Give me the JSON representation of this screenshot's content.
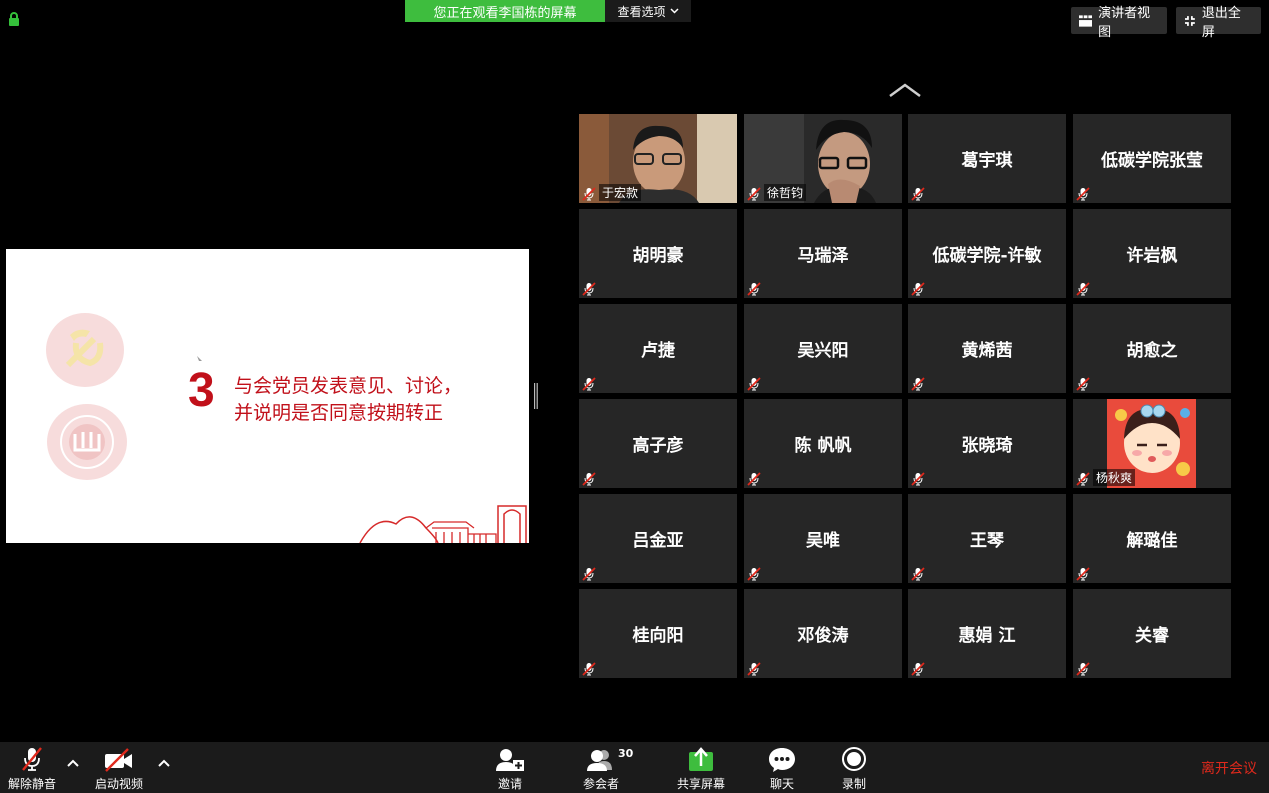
{
  "top": {
    "banner": "您正在观看李国栋的屏幕",
    "view_options": "查看选项",
    "presenter_view": "演讲者视图",
    "exit_fullscreen": "退出全屏"
  },
  "slide": {
    "number": "3",
    "line1": "与会党员发表意见、讨论，",
    "line2": "并说明是否同意按期转正"
  },
  "participants": [
    {
      "name": "于宏款",
      "video": true
    },
    {
      "name": "徐哲钧",
      "video": true
    },
    {
      "name": "葛宇琪"
    },
    {
      "name": "低碳学院张莹"
    },
    {
      "name": "胡明豪"
    },
    {
      "name": "马瑞泽"
    },
    {
      "name": "低碳学院-许敏"
    },
    {
      "name": "许岩枫"
    },
    {
      "name": "卢捷"
    },
    {
      "name": "吴兴阳"
    },
    {
      "name": "黄烯茜"
    },
    {
      "name": "胡愈之"
    },
    {
      "name": "高子彦"
    },
    {
      "name": "陈 帆帆"
    },
    {
      "name": "张晓琦"
    },
    {
      "name": "杨秋爽",
      "avatar": true
    },
    {
      "name": "吕金亚"
    },
    {
      "name": "吴唯"
    },
    {
      "name": "王琴"
    },
    {
      "name": "解璐佳"
    },
    {
      "name": "桂向阳"
    },
    {
      "name": "邓俊涛"
    },
    {
      "name": "惠娟 江"
    },
    {
      "name": "关睿"
    }
  ],
  "toolbar": {
    "unmute": "解除静音",
    "start_video": "启动视频",
    "invite": "邀请",
    "participants": "参会者",
    "participant_count": "30",
    "share_screen": "共享屏幕",
    "chat": "聊天",
    "record": "录制",
    "leave": "离开会议"
  },
  "colors": {
    "accent_green": "#3ebd3e",
    "leave_red": "#e0291c",
    "slide_red": "#c1101a",
    "tile_bg": "#262626"
  }
}
